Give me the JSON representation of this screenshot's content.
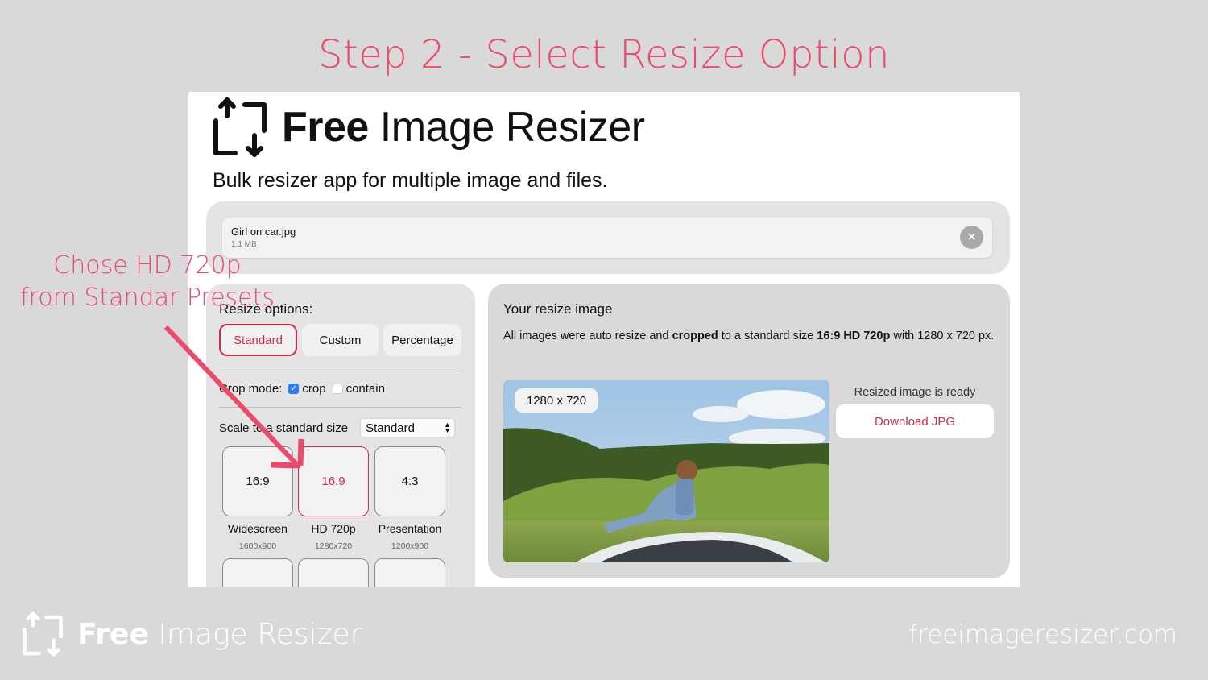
{
  "slide": {
    "title": "Step 2 - Select Resize Option",
    "annotation_line1": "Chose HD 720p",
    "annotation_line2": "from Standar Presets",
    "accent_color": "#ec4a6c"
  },
  "app": {
    "logo_icon": "resize-arrows-icon",
    "title_bold": "Free",
    "title_rest": " Image Resizer",
    "subtitle": "Bulk resizer app for multiple image and files."
  },
  "file": {
    "name": "Girl on car.jpg",
    "size": "1.1 MB",
    "remove_label": "×"
  },
  "options": {
    "heading": "Resize options:",
    "tabs": [
      {
        "label": "Standard",
        "active": true
      },
      {
        "label": "Custom",
        "active": false
      },
      {
        "label": "Percentage",
        "active": false
      }
    ],
    "crop_mode_label": "Crop mode:",
    "crop_label": "crop",
    "crop_checked": true,
    "contain_label": "contain",
    "contain_checked": false,
    "scale_label": "Scale to a standard size",
    "scale_select_value": "Standard",
    "presets": [
      {
        "ratio": "16:9",
        "name": "Widescreen",
        "dims": "1600x900",
        "selected": false
      },
      {
        "ratio": "16:9",
        "name": "HD 720p",
        "dims": "1280x720",
        "selected": true
      },
      {
        "ratio": "4:3",
        "name": "Presentation",
        "dims": "1200x900",
        "selected": false
      }
    ]
  },
  "result": {
    "title": "Your resize image",
    "desc_part1": "All images were auto resize and ",
    "desc_bold1": "cropped",
    "desc_part2": " to a standard size ",
    "desc_bold2": "16:9 HD 720p",
    "desc_part3": " with 1280 x 720 px.",
    "image_badge": "1280 x 720",
    "ready_text": "Resized image is ready",
    "download_label": "Download JPG",
    "brand_color": "#d22b4a"
  },
  "footer": {
    "title_bold": "Free",
    "title_rest": " Image Resizer",
    "url": "freeimageresizer.com"
  }
}
